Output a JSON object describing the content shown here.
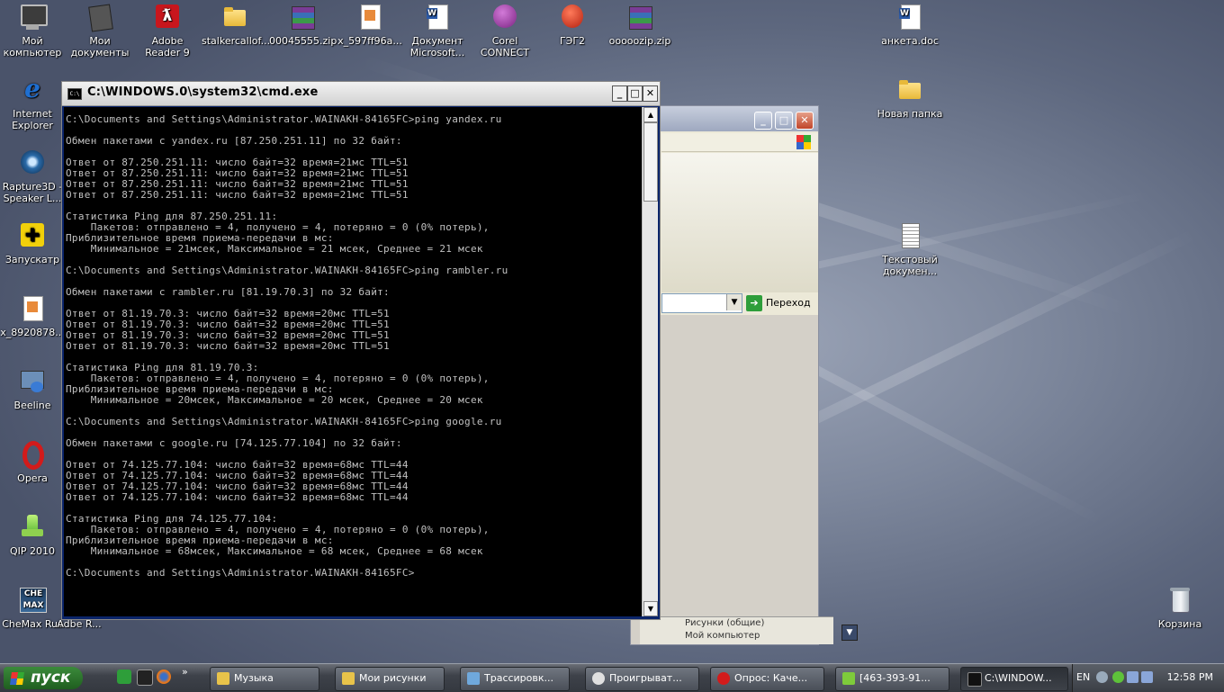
{
  "desktop": {
    "icons": [
      {
        "label": "Мой компьютер",
        "icon": "my-computer-icon"
      },
      {
        "label": "Мои документы",
        "icon": "my-documents-icon"
      },
      {
        "label": "Adobe Reader 9",
        "icon": "adobe-reader-icon"
      },
      {
        "label": "stalkercallof...",
        "icon": "folder-icon"
      },
      {
        "label": "00045555.zip",
        "icon": "winrar-archive-icon"
      },
      {
        "label": "x_597ff96a...",
        "icon": "image-file-icon"
      },
      {
        "label": "Документ Microsoft...",
        "icon": "word-document-icon"
      },
      {
        "label": "Corel CONNECT",
        "icon": "corel-connect-icon"
      },
      {
        "label": "ГЭГ2",
        "icon": "red-ball-icon"
      },
      {
        "label": "ooooozip.zip",
        "icon": "winrar-archive-icon"
      },
      {
        "label": "анкета.doc",
        "icon": "word-document-icon"
      },
      {
        "label": "Internet Explorer",
        "icon": "internet-explorer-icon"
      },
      {
        "label": "Новая папка",
        "icon": "folder-icon"
      },
      {
        "label": "Rapture3D - Speaker L...",
        "icon": "rapture3d-icon"
      },
      {
        "label": "Запускатр",
        "icon": "launcher-icon"
      },
      {
        "label": "Текстовый докумен...",
        "icon": "text-document-icon"
      },
      {
        "label": "x_8920878...",
        "icon": "image-file-icon"
      },
      {
        "label": "Beeline",
        "icon": "beeline-icon"
      },
      {
        "label": "Opera",
        "icon": "opera-icon"
      },
      {
        "label": "QIP 2010",
        "icon": "qip-icon"
      },
      {
        "label": "CheMax Rus",
        "icon": "chemax-icon"
      },
      {
        "label": "Adbe R...",
        "icon": "adobe-icon"
      },
      {
        "label": "Корзина",
        "icon": "recycle-bin-icon"
      }
    ]
  },
  "ie_window": {
    "go_label": "Переход",
    "sidebar_items": [
      "Рисунки (общие)",
      "Мой компьютер"
    ]
  },
  "cmd": {
    "title": "C:\\WINDOWS.0\\system32\\cmd.exe",
    "icon_text": "C:\\",
    "minimize": "_",
    "maximize": "□",
    "close": "✕",
    "scroll_up": "▲",
    "scroll_down": "▼",
    "output": "C:\\Documents and Settings\\Administrator.WAINAKH-84165FC>ping yandex.ru\n\nОбмен пакетами с yandex.ru [87.250.251.11] по 32 байт:\n\nОтвет от 87.250.251.11: число байт=32 время=21мс TTL=51\nОтвет от 87.250.251.11: число байт=32 время=21мс TTL=51\nОтвет от 87.250.251.11: число байт=32 время=21мс TTL=51\nОтвет от 87.250.251.11: число байт=32 время=21мс TTL=51\n\nСтатистика Ping для 87.250.251.11:\n    Пакетов: отправлено = 4, получено = 4, потеряно = 0 (0% потерь),\nПриблизительное время приема-передачи в мс:\n    Минимальное = 21мсек, Максимальное = 21 мсек, Среднее = 21 мсек\n\nC:\\Documents and Settings\\Administrator.WAINAKH-84165FC>ping rambler.ru\n\nОбмен пакетами с rambler.ru [81.19.70.3] по 32 байт:\n\nОтвет от 81.19.70.3: число байт=32 время=20мс TTL=51\nОтвет от 81.19.70.3: число байт=32 время=20мс TTL=51\nОтвет от 81.19.70.3: число байт=32 время=20мс TTL=51\nОтвет от 81.19.70.3: число байт=32 время=20мс TTL=51\n\nСтатистика Ping для 81.19.70.3:\n    Пакетов: отправлено = 4, получено = 4, потеряно = 0 (0% потерь),\nПриблизительное время приема-передачи в мс:\n    Минимальное = 20мсек, Максимальное = 20 мсек, Среднее = 20 мсек\n\nC:\\Documents and Settings\\Administrator.WAINAKH-84165FC>ping google.ru\n\nОбмен пакетами с google.ru [74.125.77.104] по 32 байт:\n\nОтвет от 74.125.77.104: число байт=32 время=68мс TTL=44\nОтвет от 74.125.77.104: число байт=32 время=68мс TTL=44\nОтвет от 74.125.77.104: число байт=32 время=68мс TTL=44\nОтвет от 74.125.77.104: число байт=32 время=68мс TTL=44\n\nСтатистика Ping для 74.125.77.104:\n    Пакетов: отправлено = 4, получено = 4, потеряно = 0 (0% потерь),\nПриблизительное время приема-передачи в мс:\n    Минимальное = 68мсек, Максимальное = 68 мсек, Среднее = 68 мсек\n\nC:\\Documents and Settings\\Administrator.WAINAKH-84165FC>"
  },
  "taskbar": {
    "start_label": "пуск",
    "more_label": "»",
    "buttons": [
      {
        "label": "Музыка",
        "icon": "folder-icon",
        "color": "#e8c34a"
      },
      {
        "label": "Мои рисунки",
        "icon": "pictures-folder-icon",
        "color": "#e8c34a"
      },
      {
        "label": "Трассировк...",
        "icon": "image-viewer-icon",
        "color": "#6fa8dc"
      },
      {
        "label": "Проигрыват...",
        "icon": "media-player-icon",
        "color": "#e0e0e0"
      },
      {
        "label": "Опрос: Каче...",
        "icon": "opera-icon",
        "color": "#d21b1b"
      },
      {
        "label": "[463-393-91...",
        "icon": "qip-chat-icon",
        "color": "#7ecb3b"
      },
      {
        "label": "C:\\WINDOW...",
        "icon": "cmd-icon",
        "color": "#111111"
      }
    ],
    "lang": "EN",
    "clock": "12:58 PM"
  }
}
